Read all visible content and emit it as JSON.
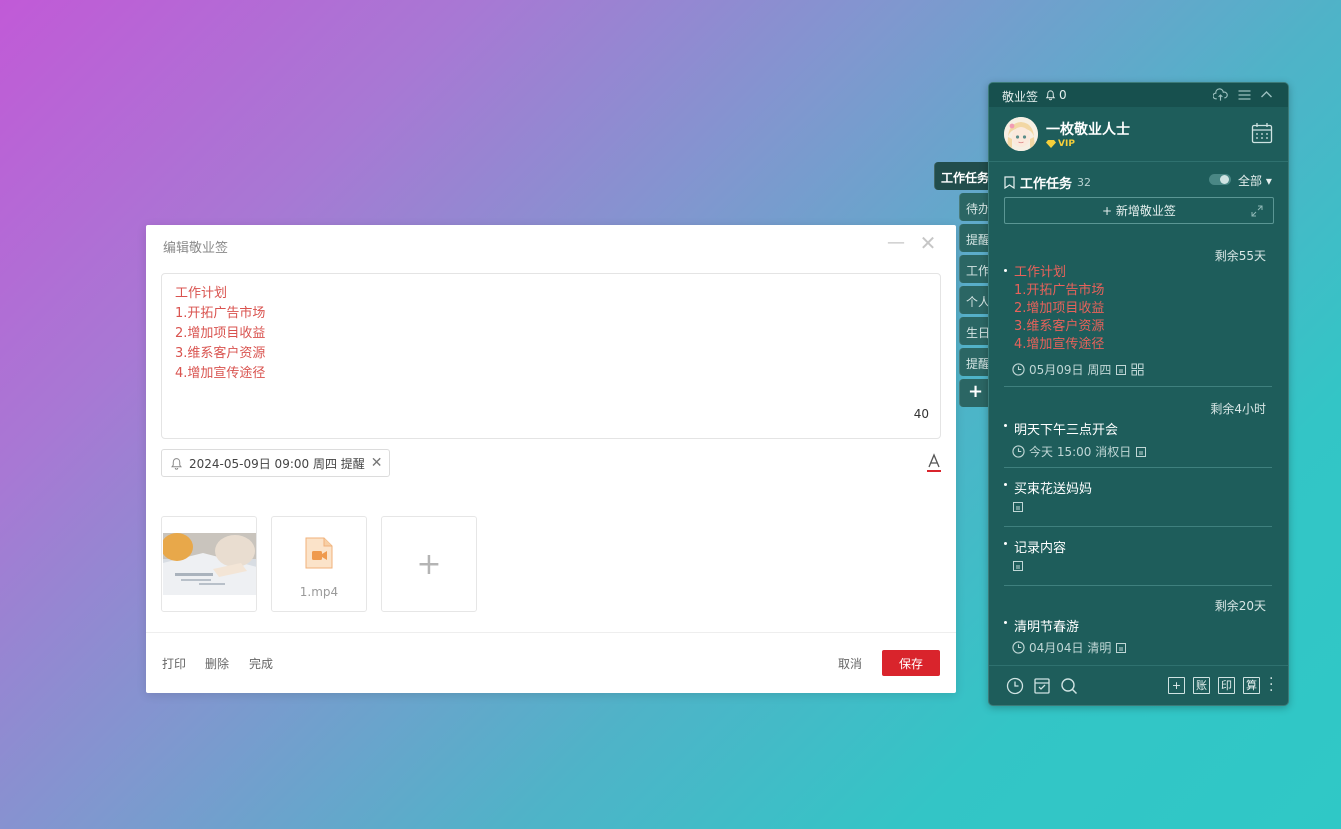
{
  "editor": {
    "title": "编辑敬业签",
    "content_lines": [
      "工作计划",
      "1.开拓广告市场",
      "2.增加项目收益",
      "3.维系客户资源",
      "4.增加宣传途径"
    ],
    "char_count": "40",
    "reminder": "2024-05-09日 09:00 周四 提醒",
    "attachments": {
      "video_name": "1.mp4"
    },
    "footer": {
      "print": "打印",
      "delete": "删除",
      "done": "完成",
      "cancel": "取消",
      "save": "保存"
    }
  },
  "side_tabs": [
    "工作任务",
    "待办",
    "提醒",
    "工作",
    "个人",
    "生日",
    "提醒"
  ],
  "panel": {
    "app_name": "敬业签",
    "notification_count": "0",
    "user_name": "一枚敬业人士",
    "vip_label": "VIP",
    "section_title": "工作任务",
    "section_count": "32",
    "filter_label": "全部",
    "new_button": "新增敬业签",
    "notes": [
      {
        "remaining": "剩余55天",
        "lines": [
          "工作计划",
          "1.开拓广告市场",
          "2.增加项目收益",
          "3.维系客户资源",
          "4.增加宣传途径"
        ],
        "meta": "05月09日 周四"
      },
      {
        "remaining": "剩余4小时",
        "title": "明天下午三点开会",
        "meta": "今天 15:00 消权日"
      },
      {
        "title": "买束花送妈妈"
      },
      {
        "title": "记录内容"
      },
      {
        "remaining": "剩余20天",
        "title": "清明节春游",
        "meta": "04月04日 清明"
      }
    ],
    "footer_buttons": [
      "账",
      "印",
      "算"
    ]
  },
  "colors": {
    "panel_bg": "#1e5d5b",
    "accent_red": "#d9242c",
    "note_red": "#e8625b",
    "vip_gold": "#f5cf3a"
  }
}
